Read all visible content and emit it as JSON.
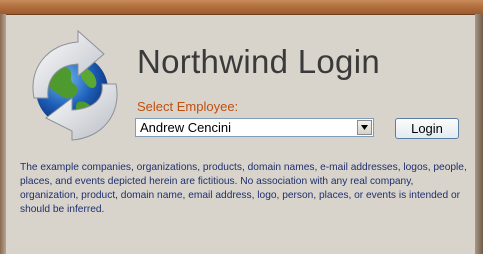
{
  "form": {
    "title": "Northwind Login",
    "select_label": "Select Employee:",
    "employee_value": "Andrew Cencini",
    "login_label": "Login",
    "disclaimer": "The example companies, organizations, products, domain names, e-mail addresses, logos, people, places, and events depicted herein are fictitious.  No association with any real company, organization, product, domain name, email address, logo, person, places, or events is intended or should be inferred."
  },
  "icons": {
    "logo": "globe-with-arrows-icon",
    "dropdown": "chevron-down-icon"
  },
  "colors": {
    "title_bar": "#b3703f",
    "background": "#d8d4cc",
    "label": "#c05010",
    "disclaimer_text": "#1f2f6e"
  }
}
